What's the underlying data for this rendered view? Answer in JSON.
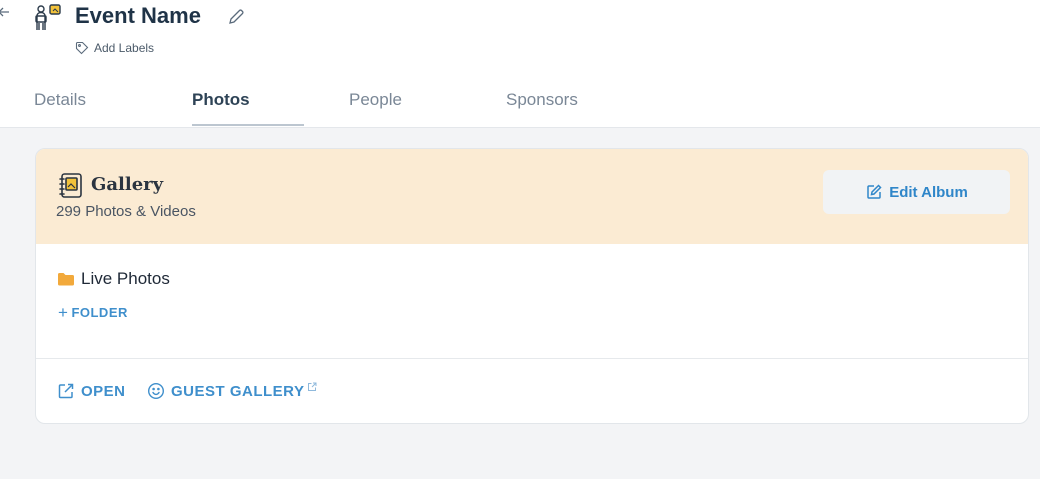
{
  "header": {
    "event_name": "Event Name",
    "add_labels": "Add Labels",
    "icons": {
      "back": "arrow-left-icon",
      "event": "event-host-icon",
      "edit": "pencil-icon",
      "label": "tag-icon"
    }
  },
  "tabs": [
    {
      "label": "Details",
      "active": false
    },
    {
      "label": "Photos",
      "active": true
    },
    {
      "label": "People",
      "active": false
    },
    {
      "label": "Sponsors",
      "active": false
    }
  ],
  "gallery": {
    "title": "Gallery",
    "count_text": "299 Photos & Videos",
    "edit_album_label": "Edit Album",
    "folders": [
      {
        "label": "Live Photos",
        "icon": "folder-icon"
      }
    ],
    "add_folder_label": "FOLDER",
    "actions": {
      "open_label": "OPEN",
      "guest_gallery_label": "GUEST GALLERY"
    }
  },
  "colors": {
    "accent": "#3f8fcc",
    "card_header": "#fbebd3",
    "folder": "#f2a93b",
    "background": "#f3f4f6"
  }
}
